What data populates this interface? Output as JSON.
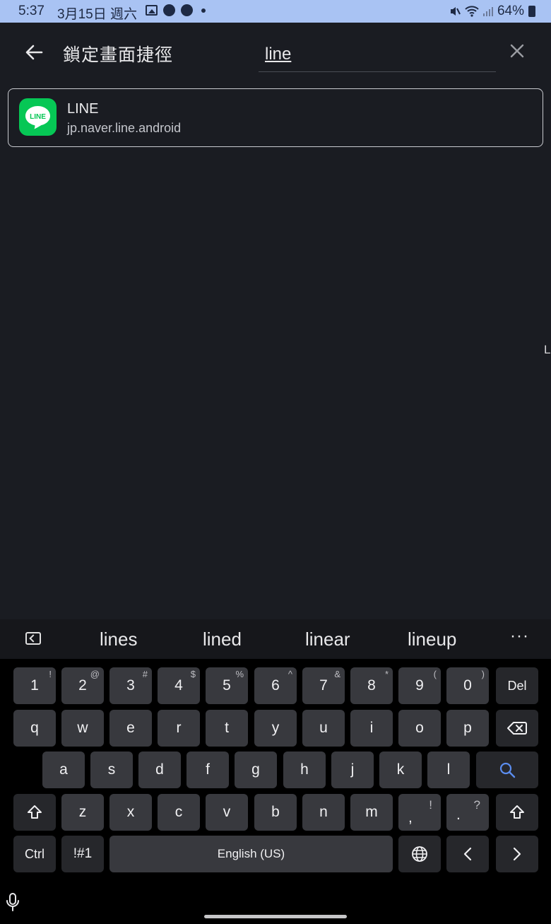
{
  "status_bar": {
    "time": "5:37",
    "date": "3月15日 週六",
    "battery": "64%"
  },
  "header": {
    "title": "鎖定畫面捷徑",
    "search_value": "line"
  },
  "results": [
    {
      "name": "LINE",
      "package": "jp.naver.line.android",
      "icon_text": "LINE"
    }
  ],
  "edge_letter": "L",
  "keyboard": {
    "suggestions": [
      "lines",
      "lined",
      "linear",
      "lineup"
    ],
    "more": "···",
    "number_row": [
      {
        "k": "1",
        "s": "!"
      },
      {
        "k": "2",
        "s": "@"
      },
      {
        "k": "3",
        "s": "#"
      },
      {
        "k": "4",
        "s": "$"
      },
      {
        "k": "5",
        "s": "%"
      },
      {
        "k": "6",
        "s": "^"
      },
      {
        "k": "7",
        "s": "&"
      },
      {
        "k": "8",
        "s": "*"
      },
      {
        "k": "9",
        "s": "("
      },
      {
        "k": "0",
        "s": ")"
      }
    ],
    "del": "Del",
    "row1": [
      "q",
      "w",
      "e",
      "r",
      "t",
      "y",
      "u",
      "i",
      "o",
      "p"
    ],
    "row2": [
      "a",
      "s",
      "d",
      "f",
      "g",
      "h",
      "j",
      "k",
      "l"
    ],
    "row3": [
      "z",
      "x",
      "c",
      "v",
      "b",
      "n",
      "m"
    ],
    "comma": ",",
    "comma_sub": "!",
    "period": ".",
    "period_sub": "?",
    "ctrl": "Ctrl",
    "symbols": "!#1",
    "space": "English (US)"
  },
  "colors": {
    "status_bar": "#a9c3f3",
    "background": "#1a1c22",
    "line_green": "#06c755",
    "search_accent": "#5b8def"
  }
}
